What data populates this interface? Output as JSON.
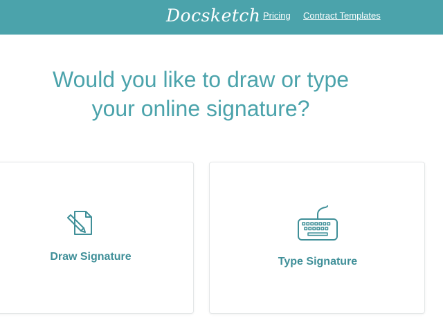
{
  "header": {
    "logo_text": "Docsketch",
    "nav": [
      {
        "label": "Pricing"
      },
      {
        "label": "Contract Templates"
      }
    ]
  },
  "main": {
    "headline_line1": "Would you like to draw or type",
    "headline_line2": "your online signature?",
    "options": [
      {
        "label": "Draw Signature",
        "icon": "pencil-document-icon"
      },
      {
        "label": "Type Signature",
        "icon": "keyboard-icon"
      }
    ]
  },
  "colors": {
    "brand": "#4ba3ab",
    "text_accent": "#3f8f98",
    "card_border": "#e3e6e7"
  }
}
